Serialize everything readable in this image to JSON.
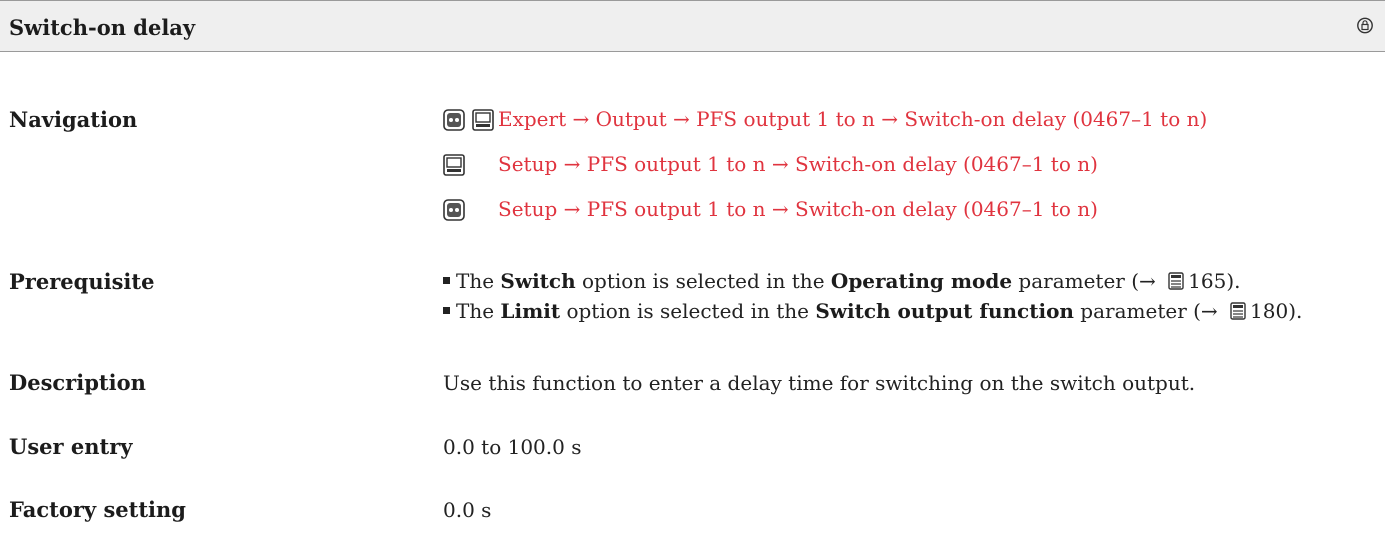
{
  "header": {
    "title": "Switch-on delay"
  },
  "navigation": {
    "label": "Navigation",
    "lines": [
      {
        "icons": [
          "display-icon",
          "operating-tool-icon"
        ],
        "path": "Expert → Output → PFS output 1 to n → Switch-on delay (0467–1 to n)"
      },
      {
        "icons": [
          "operating-tool-icon"
        ],
        "path": "Setup → PFS output 1 to n → Switch-on delay (0467–1 to n)"
      },
      {
        "icons": [
          "display-icon"
        ],
        "path": "Setup → PFS output 1 to n → Switch-on delay (0467–1 to n)"
      }
    ]
  },
  "prerequisite": {
    "label": "Prerequisite",
    "items": [
      {
        "pre": "The ",
        "option": "Switch",
        "mid": " option is selected in the ",
        "param": "Operating mode",
        "post": " parameter (→ ",
        "page": "165",
        "end": ")."
      },
      {
        "pre": "The ",
        "option": "Limit",
        "mid": " option is selected in the ",
        "param": "Switch output function",
        "post": " parameter (→ ",
        "page": "180",
        "end": ")."
      }
    ]
  },
  "description": {
    "label": "Description",
    "text": "Use this function to enter a delay time for switching on the switch output."
  },
  "user_entry": {
    "label": "User entry",
    "text": "0.0 to 100.0 s"
  },
  "factory_setting": {
    "label": "Factory setting",
    "text": "0.0 s"
  },
  "colors": {
    "nav_red": "#e0343f",
    "header_bg": "#efefef"
  }
}
